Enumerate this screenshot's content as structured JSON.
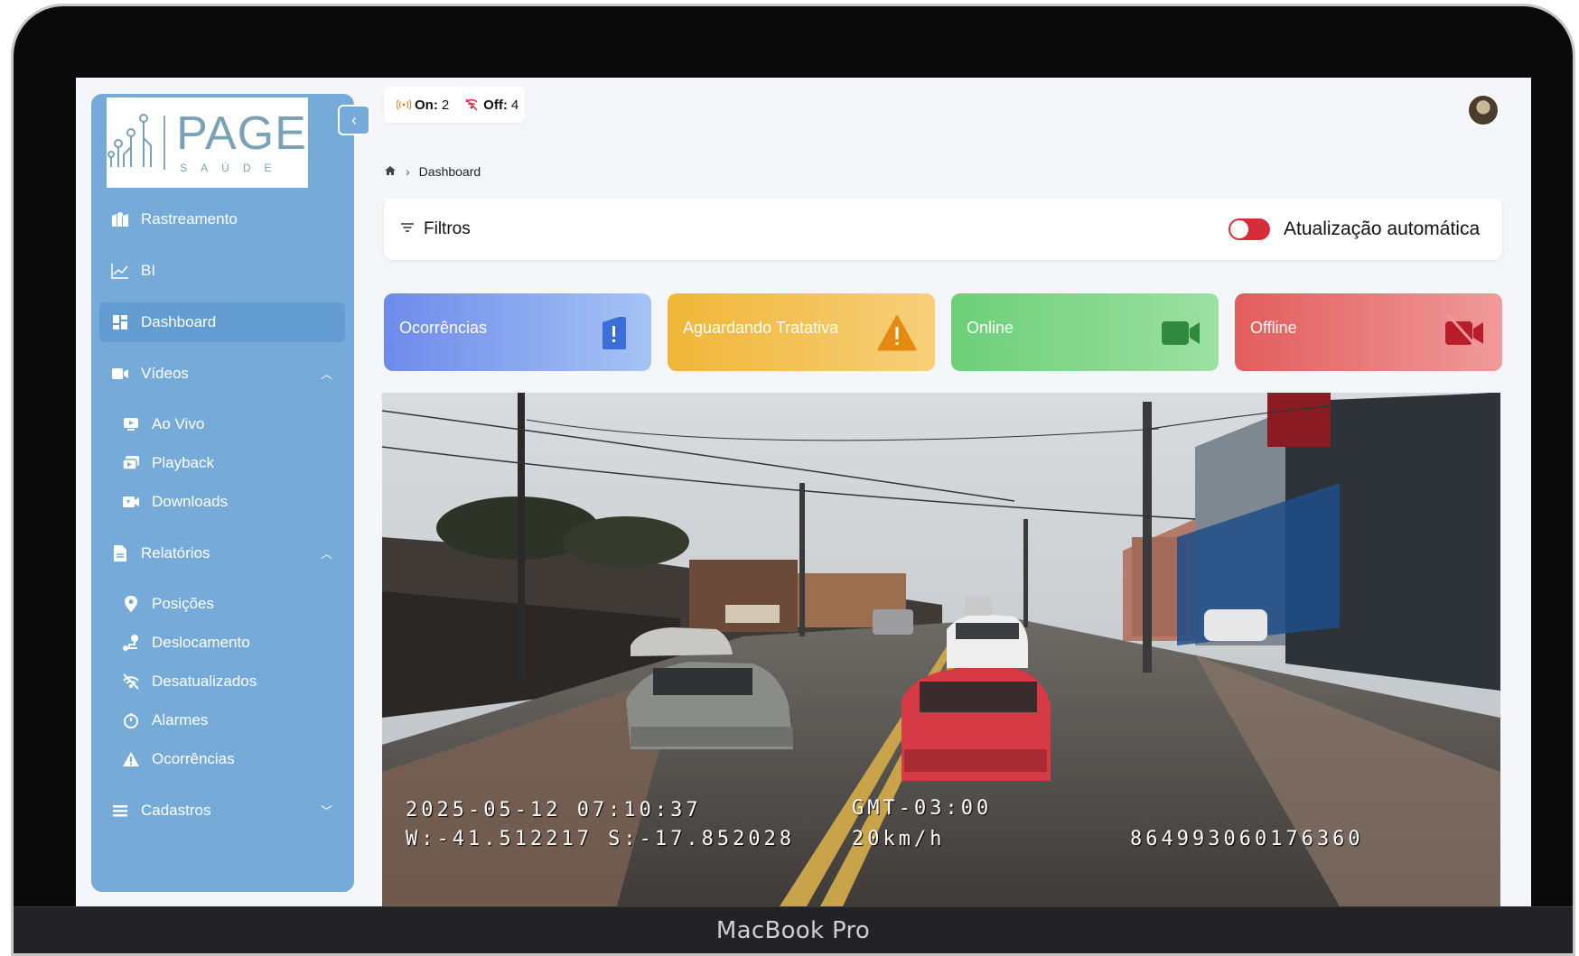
{
  "device": {
    "label": "MacBook Pro"
  },
  "logo": {
    "main": "PAGE",
    "sub": "SAÚDE"
  },
  "status": {
    "on_label": "On:",
    "on_count": "2",
    "off_label": "Off:",
    "off_count": "4"
  },
  "breadcrumb": {
    "page": "Dashboard"
  },
  "sidebar": {
    "items": [
      {
        "label": "Rastreamento",
        "icon": "map-pin-icon"
      },
      {
        "label": "BI",
        "icon": "chart-line-icon"
      },
      {
        "label": "Dashboard",
        "icon": "dashboard-icon",
        "active": true
      },
      {
        "label": "Vídeos",
        "icon": "video-icon"
      },
      {
        "label": "Ao Vivo",
        "icon": "live-icon"
      },
      {
        "label": "Playback",
        "icon": "playback-icon"
      },
      {
        "label": "Downloads",
        "icon": "download-icon"
      },
      {
        "label": "Relatórios",
        "icon": "file-icon"
      },
      {
        "label": "Posições",
        "icon": "location-icon"
      },
      {
        "label": "Deslocamento",
        "icon": "route-icon"
      },
      {
        "label": "Desatualizados",
        "icon": "signal-off-icon"
      },
      {
        "label": "Alarmes",
        "icon": "alarm-icon"
      },
      {
        "label": "Ocorrências",
        "icon": "warning-icon"
      },
      {
        "label": "Cadastros",
        "icon": "list-icon"
      }
    ]
  },
  "filters": {
    "label": "Filtros",
    "auto_update_label": "Atualização automática",
    "auto_update_on": true
  },
  "cards": [
    {
      "label": "Ocorrências",
      "icon": "alert-icon",
      "color": "#6d8bea"
    },
    {
      "label": "Aguardando Tratativa",
      "icon": "warning-triangle-icon",
      "color": "#f0b636"
    },
    {
      "label": "Online",
      "icon": "camera-icon",
      "color": "#6dcf78"
    },
    {
      "label": "Offline",
      "icon": "camera-off-icon",
      "color": "#e25d5d"
    }
  ],
  "video": {
    "datetime": "2025-05-12 07:10:37",
    "timezone": "GMT-03:00",
    "coords": "W:-41.512217 S:-17.852028",
    "speed": "20km/h",
    "device_id": "864993060176360"
  }
}
